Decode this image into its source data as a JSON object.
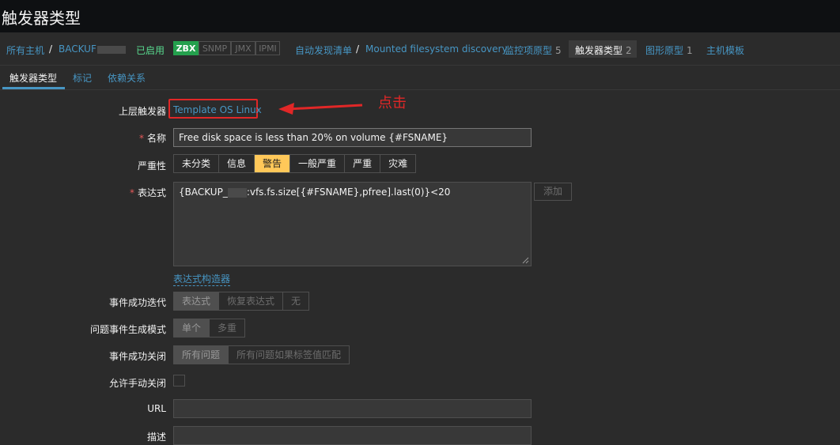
{
  "page": {
    "title": "触发器类型"
  },
  "breadcrumb": {
    "all_hosts": "所有主机",
    "sep1": "/",
    "host": "BACKUF",
    "status": "已启用",
    "protocols": [
      "ZBX",
      "SNMP",
      "JMX",
      "IPMI"
    ],
    "discovery_list": "自动发现清单",
    "sep2": "/",
    "discovery_rule": "Mounted filesystem discovery",
    "item_proto": "监控项原型",
    "item_proto_count": "5",
    "trigger_proto": "触发器类型",
    "trigger_proto_count": "2",
    "graph_proto": "图形原型",
    "graph_proto_count": "1",
    "host_template": "主机模板"
  },
  "tabs": {
    "trigger": "触发器类型",
    "tags": "标记",
    "dependencies": "依赖关系"
  },
  "annotation": {
    "text": "点击",
    "color": "#e12727"
  },
  "form": {
    "parent_label": "上层触发器",
    "parent_value": "Template OS Linux",
    "name_label": "名称",
    "name_value": "Free disk space is less than 20% on volume {#FSNAME}",
    "severity_label": "严重性",
    "severity_options": [
      "未分类",
      "信息",
      "警告",
      "一般严重",
      "严重",
      "灾难"
    ],
    "severity_selected": "警告",
    "expression_label": "表达式",
    "expression_prefix": "{BACKUP_",
    "expression_suffix": ":vfs.fs.size[{#FSNAME},pfree].last(0)}<20",
    "add_button": "添加",
    "expression_builder": "表达式构造器",
    "ok_event_gen_label": "事件成功迭代",
    "ok_event_gen_options": [
      "表达式",
      "恢复表达式",
      "无"
    ],
    "problem_mode_label": "问题事件生成模式",
    "problem_mode_options": [
      "单个",
      "多重"
    ],
    "ok_close_label": "事件成功关闭",
    "ok_close_options": [
      "所有问题",
      "所有问题如果标签值匹配"
    ],
    "manual_close_label": "允许手动关闭",
    "url_label": "URL",
    "desc_label": "描述"
  }
}
